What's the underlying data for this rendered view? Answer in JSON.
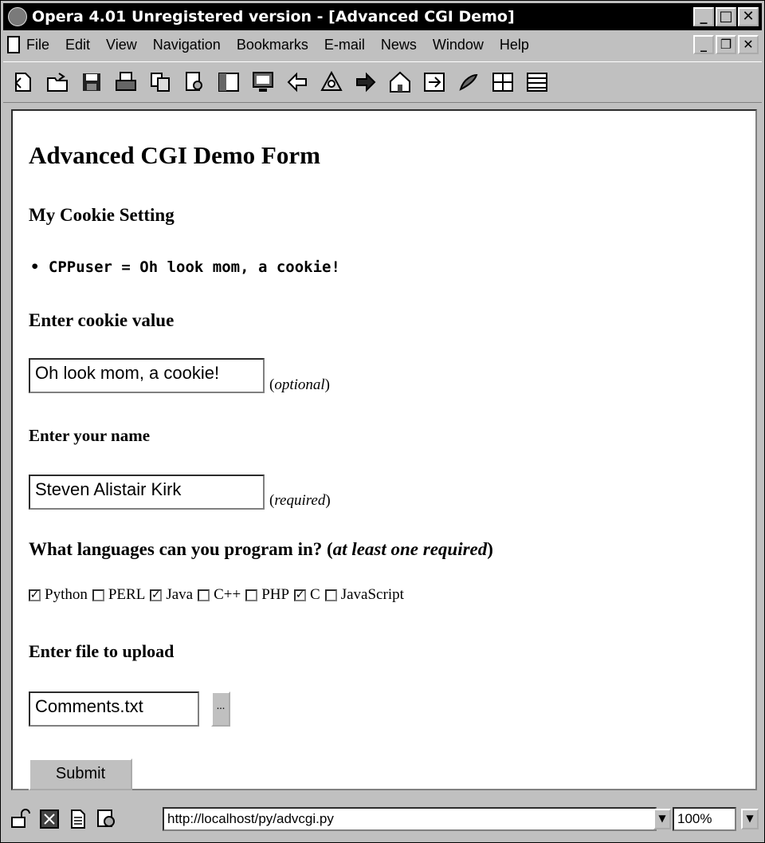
{
  "window": {
    "title": "Opera 4.01 Unregistered version - [Advanced CGI Demo]",
    "minimize": "_",
    "maximize": "□",
    "close": "✕"
  },
  "menu": {
    "items": [
      "File",
      "Edit",
      "View",
      "Navigation",
      "Bookmarks",
      "E-mail",
      "News",
      "Window",
      "Help"
    ],
    "mdi_minimize": "_",
    "mdi_restore": "❐",
    "mdi_close": "✕"
  },
  "toolbar": {
    "icons": [
      "new-page-icon",
      "open-folder-icon",
      "save-icon",
      "print-icon",
      "copy-icon",
      "find-icon",
      "hotlist-icon",
      "monitor-icon",
      "back-icon",
      "reload-icon",
      "forward-icon",
      "home-icon",
      "stop-icon",
      "bookmark-icon",
      "window-tile-icon",
      "window-cascade-icon"
    ]
  },
  "page": {
    "title": "Advanced CGI Demo Form",
    "cookie_heading": "My Cookie Setting",
    "cookie_line": "• CPPuser = Oh look mom, a cookie!",
    "cookie_input_heading": "Enter cookie value",
    "cookie_value": "Oh look mom, a cookie!",
    "cookie_hint_open": "(",
    "cookie_hint_italic": "optional",
    "cookie_hint_close": ")",
    "name_heading": "Enter your name",
    "name_value": "Steven Alistair Kirk",
    "name_hint_open": "(",
    "name_hint_italic": "required",
    "name_hint_close": ")",
    "lang_heading": "What languages can you program in? (",
    "lang_heading_italic": "at least one required",
    "lang_heading_close": ")",
    "languages": [
      {
        "label": "Python",
        "checked": true
      },
      {
        "label": "PERL",
        "checked": false
      },
      {
        "label": "Java",
        "checked": true
      },
      {
        "label": "C++",
        "checked": false
      },
      {
        "label": "PHP",
        "checked": false
      },
      {
        "label": "C",
        "checked": true
      },
      {
        "label": "JavaScript",
        "checked": false
      }
    ],
    "upload_heading": "Enter file to upload",
    "upload_value": "Comments.txt",
    "browse_label": "...",
    "submit_label": "Submit"
  },
  "status": {
    "url": "http://localhost/py/advcgi.py",
    "zoom": "100%",
    "dropdown_arrow": "▼"
  }
}
